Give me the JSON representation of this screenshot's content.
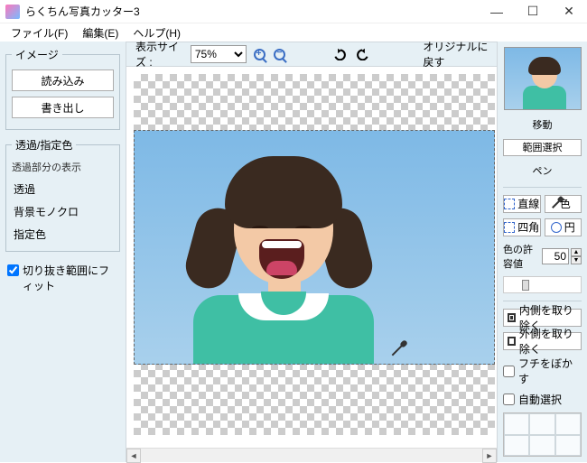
{
  "titlebar": {
    "title": "らくちん写真カッター3"
  },
  "menu": {
    "file": "ファイル(F)",
    "edit": "編集(E)",
    "help": "ヘルプ(H)"
  },
  "toolbar": {
    "zoom_label": "表示サイズ :",
    "zoom_value": "75%",
    "reset_original": "オリジナルに戻す"
  },
  "left": {
    "image_group": "イメージ",
    "load": "読み込み",
    "export": "書き出し",
    "trans_group": "透過/指定色",
    "trans_sublabel": "透過部分の表示",
    "opt_trans": "透過",
    "opt_mono": "背景モノクロ",
    "opt_color": "指定色",
    "fit_crop": "切り抜き範囲にフィット"
  },
  "right": {
    "move": "移動",
    "range_select": "範囲選択",
    "pen": "ペン",
    "line": "直線",
    "color": "色",
    "rect": "四角",
    "circle": "円",
    "tolerance_label": "色の許容値",
    "tolerance_value": "50",
    "remove_inside": "内側を取り除く",
    "remove_outside": "外側を取り除く",
    "blur_edge": "フチをぼかす",
    "auto_select": "自動選択"
  }
}
